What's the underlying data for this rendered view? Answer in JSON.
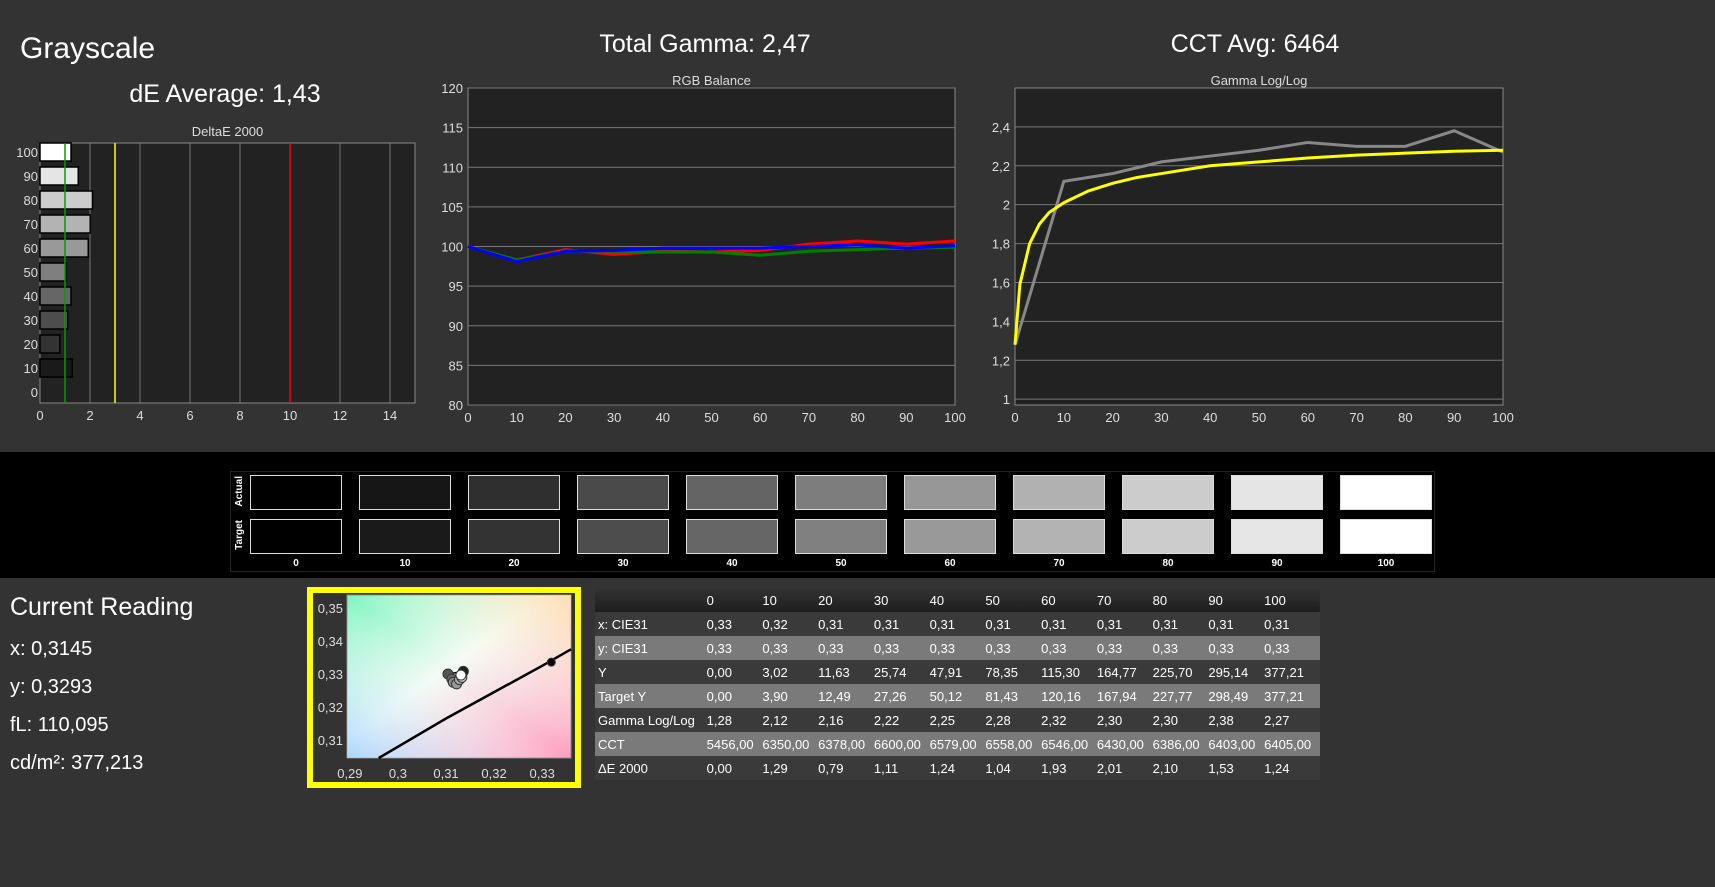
{
  "header": {
    "title": "Grayscale",
    "de_average": "dE Average: 1,43",
    "total_gamma": "Total Gamma: 2,47",
    "cct_avg": "CCT Avg: 6464"
  },
  "chart_data": [
    {
      "type": "bar",
      "title": "DeltaE 2000",
      "orientation": "horizontal",
      "categories": [
        0,
        10,
        20,
        30,
        40,
        50,
        60,
        70,
        80,
        90,
        100
      ],
      "values": [
        0.0,
        1.29,
        0.79,
        1.11,
        1.24,
        1.04,
        1.93,
        2.01,
        2.1,
        1.53,
        1.24
      ],
      "xlim": [
        0,
        15
      ],
      "xticks": [
        0,
        2,
        4,
        6,
        8,
        10,
        12,
        14
      ],
      "reference_lines": [
        {
          "value": 1,
          "color": "#00a000"
        },
        {
          "value": 3,
          "color": "#ffff00"
        },
        {
          "value": 10,
          "color": "#ff0000"
        }
      ],
      "grid": true
    },
    {
      "type": "line",
      "title": "RGB Balance",
      "x": [
        0,
        10,
        20,
        30,
        40,
        50,
        60,
        70,
        80,
        90,
        100
      ],
      "ylim": [
        80,
        120
      ],
      "yticks": [
        80,
        85,
        90,
        95,
        100,
        105,
        110,
        115,
        120
      ],
      "xticks": [
        0,
        10,
        20,
        30,
        40,
        50,
        60,
        70,
        80,
        90,
        100
      ],
      "grid": true,
      "series": [
        {
          "color": "#ff0000",
          "values": [
            100,
            98.3,
            99.6,
            99.0,
            99.4,
            99.3,
            99.5,
            100.3,
            100.7,
            100.3,
            100.7
          ]
        },
        {
          "color": "#008000",
          "values": [
            100,
            98.3,
            99.4,
            99.4,
            99.3,
            99.3,
            98.9,
            99.4,
            99.6,
            99.8,
            99.9
          ]
        },
        {
          "color": "#0000ff",
          "values": [
            100,
            98.1,
            99.4,
            99.5,
            99.8,
            99.8,
            99.8,
            100.0,
            100.2,
            99.8,
            100.1
          ]
        }
      ]
    },
    {
      "type": "line",
      "title": "Gamma Log/Log",
      "x": [
        0,
        10,
        20,
        30,
        40,
        50,
        60,
        70,
        80,
        90,
        100
      ],
      "ylim": [
        0.97,
        2.6
      ],
      "yticks": [
        1,
        1.2,
        1.4,
        1.6,
        1.8,
        2,
        2.2,
        2.4
      ],
      "ytick_labels": [
        "1",
        "1,2",
        "1,4",
        "1,6",
        "1,8",
        "2",
        "2,2",
        "2,4"
      ],
      "xticks": [
        0,
        10,
        20,
        30,
        40,
        50,
        60,
        70,
        80,
        90,
        100
      ],
      "grid": true,
      "series": [
        {
          "color": "#888888",
          "values": [
            1.28,
            2.12,
            2.16,
            2.22,
            2.25,
            2.28,
            2.32,
            2.3,
            2.3,
            2.38,
            2.27
          ]
        },
        {
          "color": "#ffff00",
          "x": [
            0,
            1,
            3,
            5,
            7,
            10,
            15,
            20,
            25,
            30,
            40,
            50,
            60,
            70,
            80,
            90,
            100
          ],
          "values": [
            1.28,
            1.59,
            1.8,
            1.9,
            1.96,
            2.01,
            2.07,
            2.11,
            2.14,
            2.16,
            2.2,
            2.22,
            2.24,
            2.255,
            2.265,
            2.275,
            2.28
          ]
        }
      ]
    },
    {
      "type": "scatter",
      "title": "",
      "xlim": [
        0.2894,
        0.336
      ],
      "ylim": [
        0.3045,
        0.354
      ],
      "xticks": [
        0.29,
        0.3,
        0.31,
        0.32,
        0.33
      ],
      "xtick_labels": [
        "0,29",
        "0,3",
        "0,31",
        "0,32",
        "0,33"
      ],
      "yticks": [
        0.31,
        0.32,
        0.33,
        0.34,
        0.35
      ],
      "ytick_labels": [
        "0,31",
        "0,32",
        "0,33",
        "0,34",
        "0,35"
      ],
      "points": [
        {
          "x": 0.3319,
          "y": 0.3336,
          "color": "#000000"
        },
        {
          "x": 0.3104,
          "y": 0.33,
          "color": "#555555"
        },
        {
          "x": 0.3136,
          "y": 0.3308,
          "color": "#222222"
        },
        {
          "x": 0.3112,
          "y": 0.3285,
          "color": "#666666"
        },
        {
          "x": 0.3115,
          "y": 0.3275,
          "color": "#888888"
        },
        {
          "x": 0.3122,
          "y": 0.327,
          "color": "#999999"
        },
        {
          "x": 0.3128,
          "y": 0.3283,
          "color": "#aaaaaa"
        },
        {
          "x": 0.3133,
          "y": 0.329,
          "color": "#cccccc"
        },
        {
          "x": 0.3131,
          "y": 0.3297,
          "color": "#ffffff"
        }
      ],
      "planckian_locus": [
        [
          0.296,
          0.3045
        ],
        [
          0.31,
          0.3165
        ],
        [
          0.32,
          0.3245
        ],
        [
          0.33,
          0.3325
        ],
        [
          0.336,
          0.3375
        ]
      ]
    }
  ],
  "swatches": {
    "row_labels": [
      "Actual",
      "Target"
    ],
    "levels": [
      "0",
      "10",
      "20",
      "30",
      "40",
      "50",
      "60",
      "70",
      "80",
      "90",
      "100"
    ],
    "actual_colors": [
      "#000000",
      "#161616",
      "#2f2f2f",
      "#4a4a4a",
      "#646464",
      "#7d7d7d",
      "#979797",
      "#b1b1b1",
      "#cccccc",
      "#e5e5e5",
      "#ffffff"
    ],
    "target_colors": [
      "#000000",
      "#1a1a1a",
      "#333333",
      "#4d4d4d",
      "#666666",
      "#808080",
      "#999999",
      "#b3b3b3",
      "#cccccc",
      "#e6e6e6",
      "#ffffff"
    ]
  },
  "current_reading": {
    "title": "Current Reading",
    "x": "x: 0,3145",
    "y": "y: 0,3293",
    "fl": "fL: 110,095",
    "cdm2": "cd/m²: 377,213"
  },
  "table": {
    "columns": [
      "",
      "0",
      "10",
      "20",
      "30",
      "40",
      "50",
      "60",
      "70",
      "80",
      "90",
      "100"
    ],
    "rows": [
      {
        "label": "x: CIE31",
        "values": [
          "0,33",
          "0,32",
          "0,31",
          "0,31",
          "0,31",
          "0,31",
          "0,31",
          "0,31",
          "0,31",
          "0,31",
          "0,31"
        ]
      },
      {
        "label": "y: CIE31",
        "values": [
          "0,33",
          "0,33",
          "0,33",
          "0,33",
          "0,33",
          "0,33",
          "0,33",
          "0,33",
          "0,33",
          "0,33",
          "0,33"
        ]
      },
      {
        "label": "Y",
        "values": [
          "0,00",
          "3,02",
          "11,63",
          "25,74",
          "47,91",
          "78,35",
          "115,30",
          "164,77",
          "225,70",
          "295,14",
          "377,21"
        ]
      },
      {
        "label": "Target Y",
        "values": [
          "0,00",
          "3,90",
          "12,49",
          "27,26",
          "50,12",
          "81,43",
          "120,16",
          "167,94",
          "227,77",
          "298,49",
          "377,21"
        ]
      },
      {
        "label": "Gamma Log/Log",
        "values": [
          "1,28",
          "2,12",
          "2,16",
          "2,22",
          "2,25",
          "2,28",
          "2,32",
          "2,30",
          "2,30",
          "2,38",
          "2,27"
        ]
      },
      {
        "label": "CCT",
        "values": [
          "5456,00",
          "6350,00",
          "6378,00",
          "6600,00",
          "6579,00",
          "6558,00",
          "6546,00",
          "6430,00",
          "6386,00",
          "6403,00",
          "6405,00"
        ]
      },
      {
        "label": "ΔE 2000",
        "values": [
          "0,00",
          "1,29",
          "0,79",
          "1,11",
          "1,24",
          "1,04",
          "1,93",
          "2,01",
          "2,10",
          "1,53",
          "1,24"
        ]
      }
    ]
  }
}
